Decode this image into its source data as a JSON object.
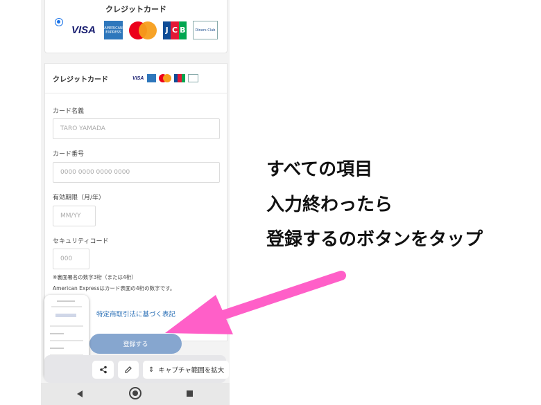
{
  "payment_option": {
    "title": "クレジットカード",
    "logos": {
      "visa": "VISA",
      "amex": "AMERICAN EXPRESS",
      "jcb": [
        "J",
        "C",
        "B"
      ],
      "diners": "Diners Club"
    }
  },
  "form": {
    "header_title": "クレジットカード",
    "card_name_label": "カード名義",
    "card_name_placeholder": "TARO YAMADA",
    "card_number_label": "カード番号",
    "card_number_placeholder": "0000 0000 0000 0000",
    "expiry_label": "有効期限（月/年）",
    "expiry_placeholder": "MM/YY",
    "cvc_label": "セキュリティコード",
    "cvc_placeholder": "000",
    "note1": "※裏面署名の数字3桁（または4桁）",
    "note2": "American Expressはカード表面の4桁の数字です。",
    "legal_link": "特定商取引法に基づく表記",
    "submit_label": "登録する"
  },
  "screenshot_toolbar": {
    "share_icon": "share-icon",
    "edit_icon": "pencil-icon",
    "expand_label": "キャプチャ範囲を拡大"
  },
  "annotation": {
    "lines": [
      "すべての項目",
      "入力終わったら",
      "登録するのボタンをタップ"
    ],
    "arrow_color": "#ff5fc8"
  },
  "colors": {
    "accent": "#1a73e8",
    "submit_bg": "#86a6cf",
    "link": "#2a6fb6"
  }
}
